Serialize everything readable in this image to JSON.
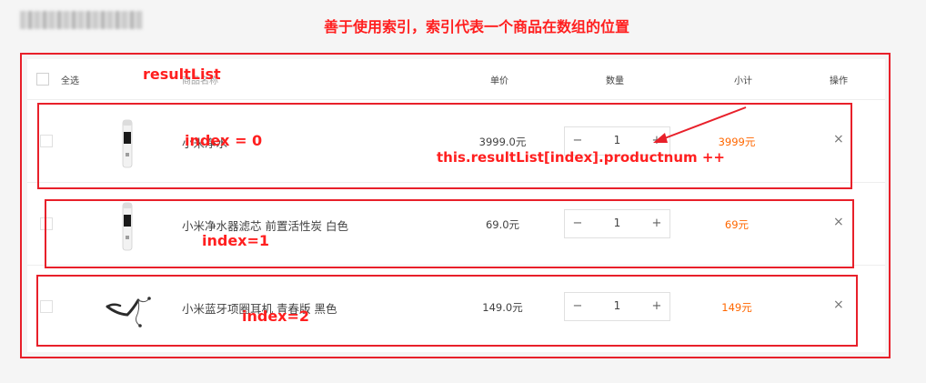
{
  "annotation": {
    "top_note": "善于使用索引，索引代表一个商品在数组的位置",
    "result_list": "resultList",
    "index_labels": [
      "index = 0",
      "index=1",
      "index=2"
    ],
    "arrow_note": "this.resultList[index].productnum ++"
  },
  "cart": {
    "header": {
      "select_all": "全选",
      "product_name": "商品名称",
      "unit_price": "单价",
      "quantity": "数量",
      "subtotal": "小计",
      "actions": "操作"
    },
    "items": [
      {
        "name": "小米净水",
        "price": "3999.0元",
        "quantity": "1",
        "subtotal": "3999元",
        "thumb_icon": "water-filter-icon"
      },
      {
        "name": "小米净水器滤芯 前置活性炭 白色",
        "price": "69.0元",
        "quantity": "1",
        "subtotal": "69元",
        "thumb_icon": "water-filter-icon"
      },
      {
        "name": "小米蓝牙项圈耳机 青春版 黑色",
        "price": "149.0元",
        "quantity": "1",
        "subtotal": "149元",
        "thumb_icon": "neckband-earphone-icon"
      }
    ],
    "stepper": {
      "minus": "−",
      "plus": "+"
    },
    "delete_symbol": "×"
  },
  "colors": {
    "annotation_red": "#e8202a",
    "subtotal_orange": "#ff6700"
  }
}
